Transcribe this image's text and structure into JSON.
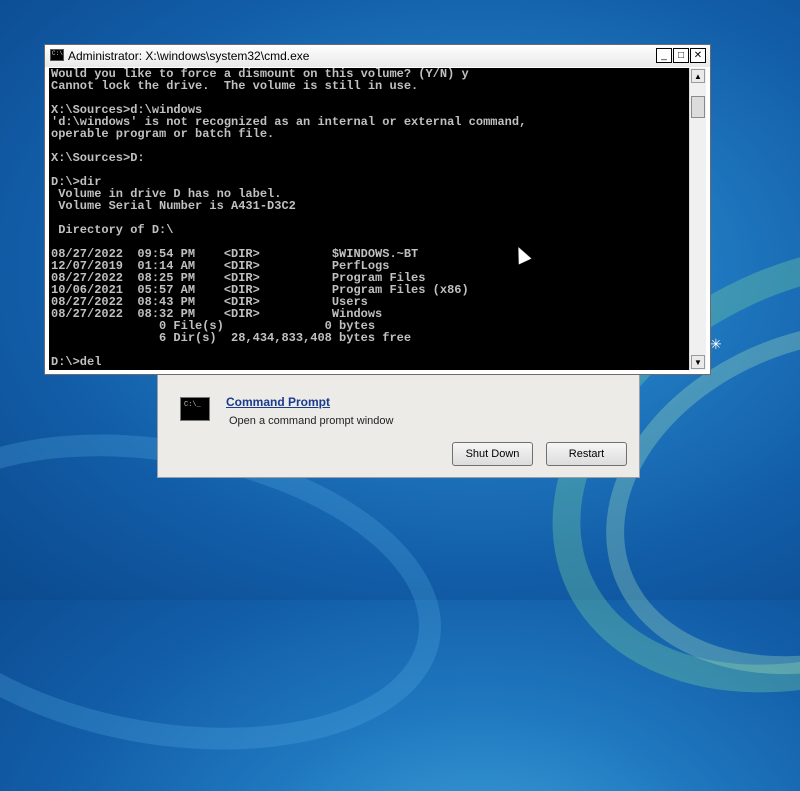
{
  "cmd_window": {
    "title": "Administrator: X:\\windows\\system32\\cmd.exe",
    "controls": {
      "minimize": "_",
      "maximize": "□",
      "close": "✕"
    },
    "lines": [
      "Would you like to force a dismount on this volume? (Y/N) y",
      "Cannot lock the drive.  The volume is still in use.",
      "",
      "X:\\Sources>d:\\windows",
      "'d:\\windows' is not recognized as an internal or external command,",
      "operable program or batch file.",
      "",
      "X:\\Sources>D:",
      "",
      "D:\\>dir",
      " Volume in drive D has no label.",
      " Volume Serial Number is A431-D3C2",
      "",
      " Directory of D:\\",
      "",
      "08/27/2022  09:54 PM    <DIR>          $WINDOWS.~BT",
      "12/07/2019  01:14 AM    <DIR>          PerfLogs",
      "08/27/2022  08:25 PM    <DIR>          Program Files",
      "10/06/2021  05:57 AM    <DIR>          Program Files (x86)",
      "08/27/2022  08:43 PM    <DIR>          Users",
      "08/27/2022  08:32 PM    <DIR>          Windows",
      "               0 File(s)              0 bytes",
      "               6 Dir(s)  28,434,833,408 bytes free",
      "",
      "D:\\>del"
    ]
  },
  "recovery_panel": {
    "icon_text": "C:\\_",
    "title": "Command Prompt",
    "description": "Open a command prompt window",
    "shutdown_label": "Shut Down",
    "restart_label": "Restart"
  },
  "colors": {
    "console_bg": "#000000",
    "console_fg": "#c0c0c0",
    "link": "#1a3b8f"
  }
}
